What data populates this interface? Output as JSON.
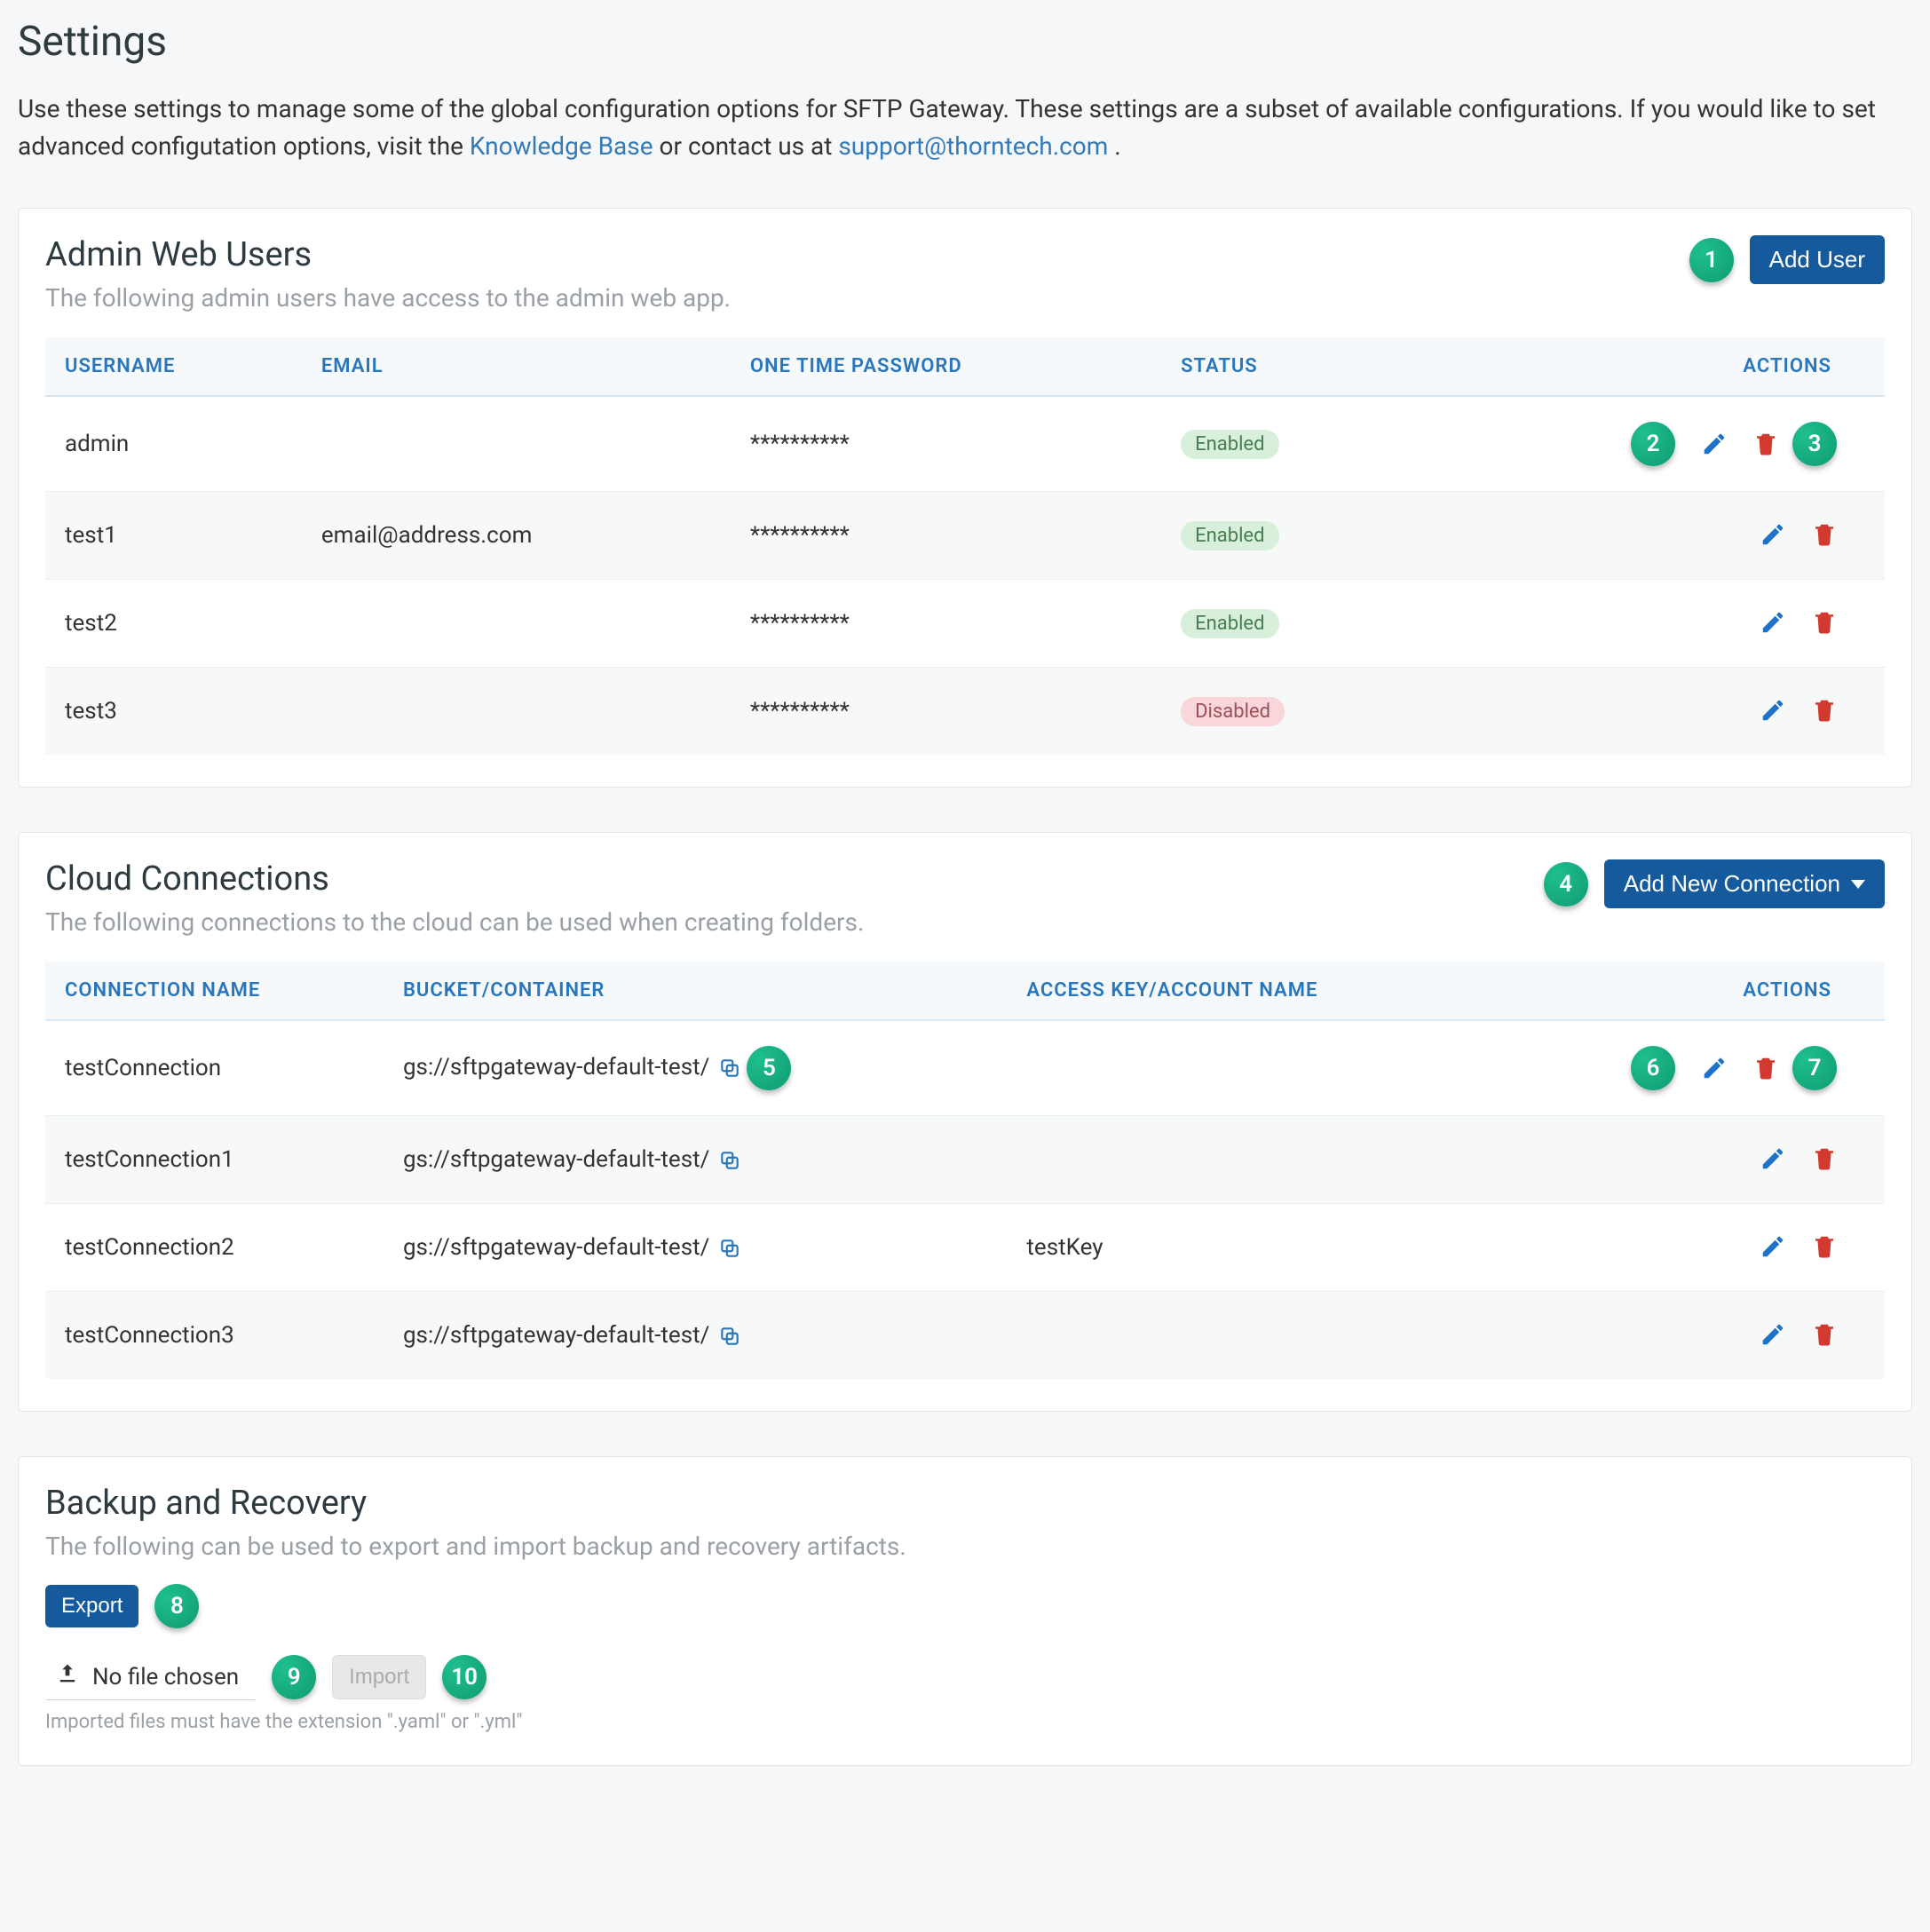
{
  "page": {
    "title": "Settings",
    "desc_before": "Use these settings to manage some of the global configuration options for SFTP Gateway. These settings are a subset of available configurations. If you would like to set advanced configutation options, visit the ",
    "link1": "Knowledge Base",
    "desc_mid": " or contact us at ",
    "link2": "support@thorntech.com",
    "desc_after": "."
  },
  "admin": {
    "title": "Admin Web Users",
    "subtitle": "The following admin users have access to the admin web app.",
    "add_btn": "Add User",
    "columns": {
      "username": "USERNAME",
      "email": "EMAIL",
      "otp": "ONE TIME PASSWORD",
      "status": "STATUS",
      "actions": "ACTIONS"
    },
    "rows": [
      {
        "username": "admin",
        "email": "",
        "otp": "**********",
        "status": "Enabled",
        "enabled": true
      },
      {
        "username": "test1",
        "email": "email@address.com",
        "otp": "**********",
        "status": "Enabled",
        "enabled": true
      },
      {
        "username": "test2",
        "email": "",
        "otp": "**********",
        "status": "Enabled",
        "enabled": true
      },
      {
        "username": "test3",
        "email": "",
        "otp": "**********",
        "status": "Disabled",
        "enabled": false
      }
    ]
  },
  "cloud": {
    "title": "Cloud Connections",
    "subtitle": "The following connections to the cloud can be used when creating folders.",
    "add_btn": "Add New Connection",
    "columns": {
      "name": "CONNECTION NAME",
      "bucket": "BUCKET/CONTAINER",
      "key": "ACCESS KEY/ACCOUNT NAME",
      "actions": "ACTIONS"
    },
    "rows": [
      {
        "name": "testConnection",
        "bucket": "gs://sftpgateway-default-test/",
        "key": ""
      },
      {
        "name": "testConnection1",
        "bucket": "gs://sftpgateway-default-test/",
        "key": ""
      },
      {
        "name": "testConnection2",
        "bucket": "gs://sftpgateway-default-test/",
        "key": "testKey"
      },
      {
        "name": "testConnection3",
        "bucket": "gs://sftpgateway-default-test/",
        "key": ""
      }
    ]
  },
  "backup": {
    "title": "Backup and Recovery",
    "subtitle": "The following can be used to export and import backup and recovery artifacts.",
    "export_btn": "Export",
    "file_label": "No file chosen",
    "import_btn": "Import",
    "hint": "Imported files must have the extension \".yaml\" or \".yml\""
  },
  "markers": {
    "m1": "1",
    "m2": "2",
    "m3": "3",
    "m4": "4",
    "m5": "5",
    "m6": "6",
    "m7": "7",
    "m8": "8",
    "m9": "9",
    "m10": "10"
  }
}
